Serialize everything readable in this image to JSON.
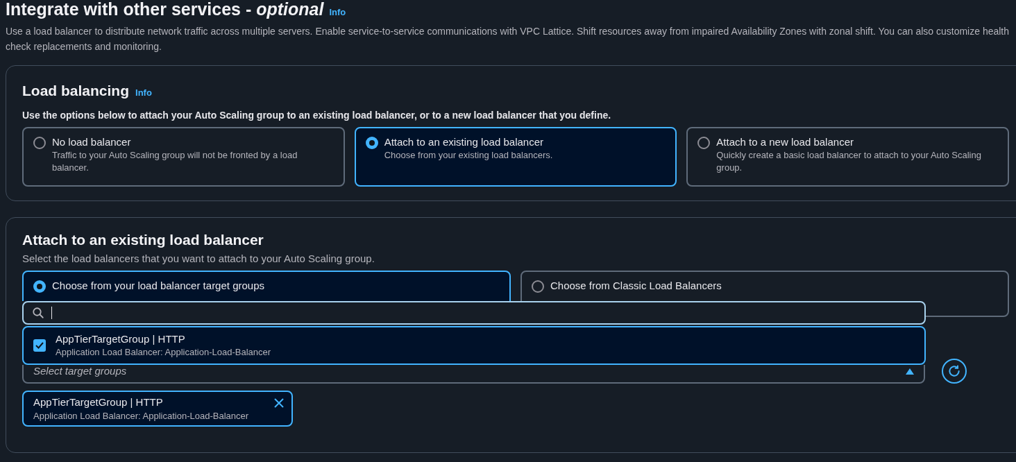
{
  "header": {
    "title": "Integrate with other services - *optional*",
    "info": "Info",
    "description": "Use a load balancer to distribute network traffic across multiple servers. Enable service-to-service communications with VPC Lattice. Shift resources away from impaired Availability Zones with zonal shift. You can also customize health check replacements and monitoring."
  },
  "load_balancing": {
    "title": "Load balancing",
    "info": "Info",
    "instruction": "Use the options below to attach your Auto Scaling group to an existing load balancer, or to a new load balancer that you define.",
    "options": [
      {
        "label": "No load balancer",
        "description": "Traffic to your Auto Scaling group will not be fronted by a load balancer.",
        "selected": false
      },
      {
        "label": "Attach to an existing load balancer",
        "description": "Choose from your existing load balancers.",
        "selected": true
      },
      {
        "label": "Attach to a new load balancer",
        "description": "Quickly create a basic load balancer to attach to your Auto Scaling group.",
        "selected": false
      }
    ]
  },
  "attach": {
    "title": "Attach to an existing load balancer",
    "description": "Select the load balancers that you want to attach to your Auto Scaling group.",
    "sources": [
      {
        "label": "Choose from your load balancer target groups",
        "selected": true
      },
      {
        "label": "Choose from Classic Load Balancers",
        "selected": false
      }
    ],
    "target_groups": {
      "placeholder": "Select target groups",
      "expanded": true,
      "options": [
        {
          "name": "AppTierTargetGroup | HTTP",
          "detail": "Application Load Balancer: Application-Load-Balancer",
          "checked": true
        }
      ],
      "tokens": [
        {
          "name": "AppTierTargetGroup | HTTP",
          "detail": "Application Load Balancer: Application-Load-Balancer"
        }
      ]
    }
  }
}
